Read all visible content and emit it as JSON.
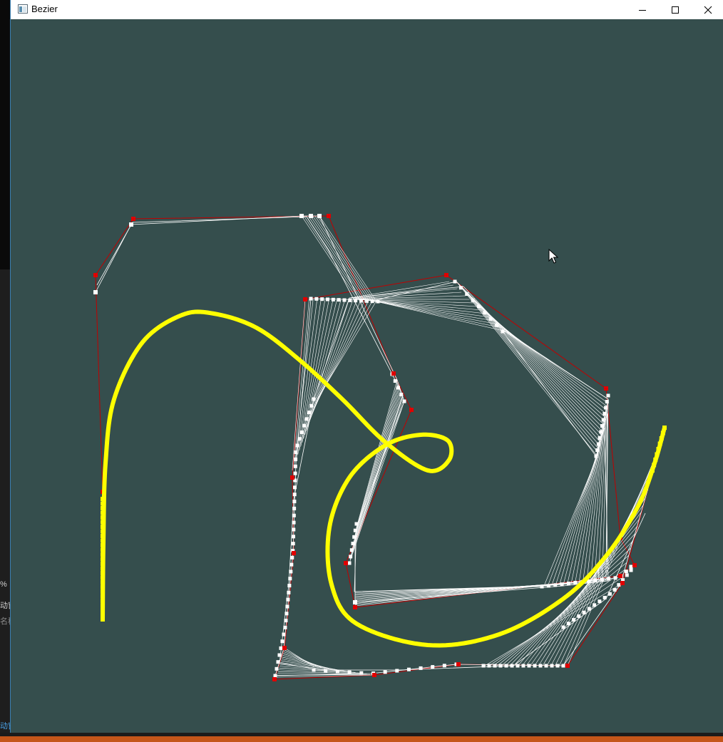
{
  "window": {
    "title": "Bezier",
    "minimize_icon": "minimize-icon",
    "maximize_icon": "maximize-icon",
    "close_icon": "close-icon",
    "app_icon": "window-app-icon"
  },
  "background_app": {
    "fragments": [
      "%",
      "动窗",
      "名称",
      "动窗"
    ]
  },
  "colors": {
    "canvas_background": "#354e4d",
    "bezier_curve": "#ffff00",
    "control_polygon": "#c00000",
    "control_point": "#e00000",
    "construction_lines": "#ffffff",
    "taskbar_accent": "#c4561a"
  },
  "cursor_icon": "mouse-pointer-icon"
}
